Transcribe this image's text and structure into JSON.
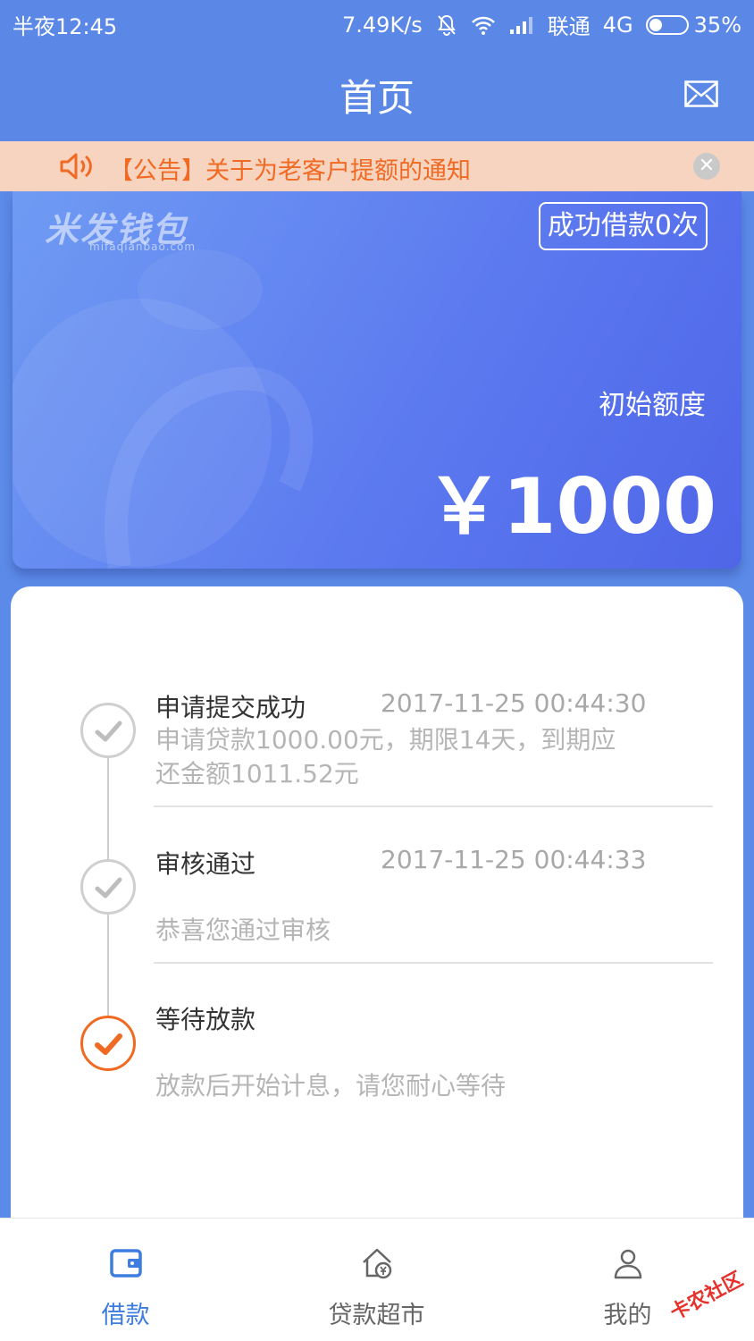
{
  "status_bar": {
    "time": "半夜12:45",
    "speed": "7.49K/s",
    "carrier": "联通",
    "network": "4G",
    "battery": "35%",
    "battery_level": 0.35
  },
  "header": {
    "title": "首页",
    "mail_icon": "mail-icon"
  },
  "notice": {
    "text": "【公告】关于为老客户提额的通知",
    "speaker_icon": "speaker-icon",
    "close_icon": "close-icon"
  },
  "card": {
    "brand": "米发钱包",
    "brand_sub": "mifaqianbao.com",
    "badge": "成功借款0次",
    "limit_label": "初始额度",
    "amount": "￥1000"
  },
  "timeline": [
    {
      "name": "申请提交成功",
      "time": "2017-11-25 00:44:30",
      "desc": "申请贷款1000.00元，期限14天，到期应还金额1011.52元",
      "done": true
    },
    {
      "name": "审核通过",
      "time": "2017-11-25 00:44:33",
      "desc": "恭喜您通过审核",
      "done": true
    },
    {
      "name": "等待放款",
      "time": "",
      "desc": "放款后开始计息，请您耐心等待",
      "current": true
    }
  ],
  "tabs": [
    {
      "label": "借款",
      "icon": "wallet-icon",
      "active": true
    },
    {
      "label": "贷款超市",
      "icon": "house-yuan-icon",
      "active": false
    },
    {
      "label": "我的",
      "icon": "person-icon",
      "active": false
    }
  ],
  "watermark": "卡农社区",
  "colors": {
    "primary": "#5b88e6",
    "accent_orange": "#f06a24",
    "notice_bg": "#f7d4bf",
    "tab_active": "#3d7de0"
  }
}
